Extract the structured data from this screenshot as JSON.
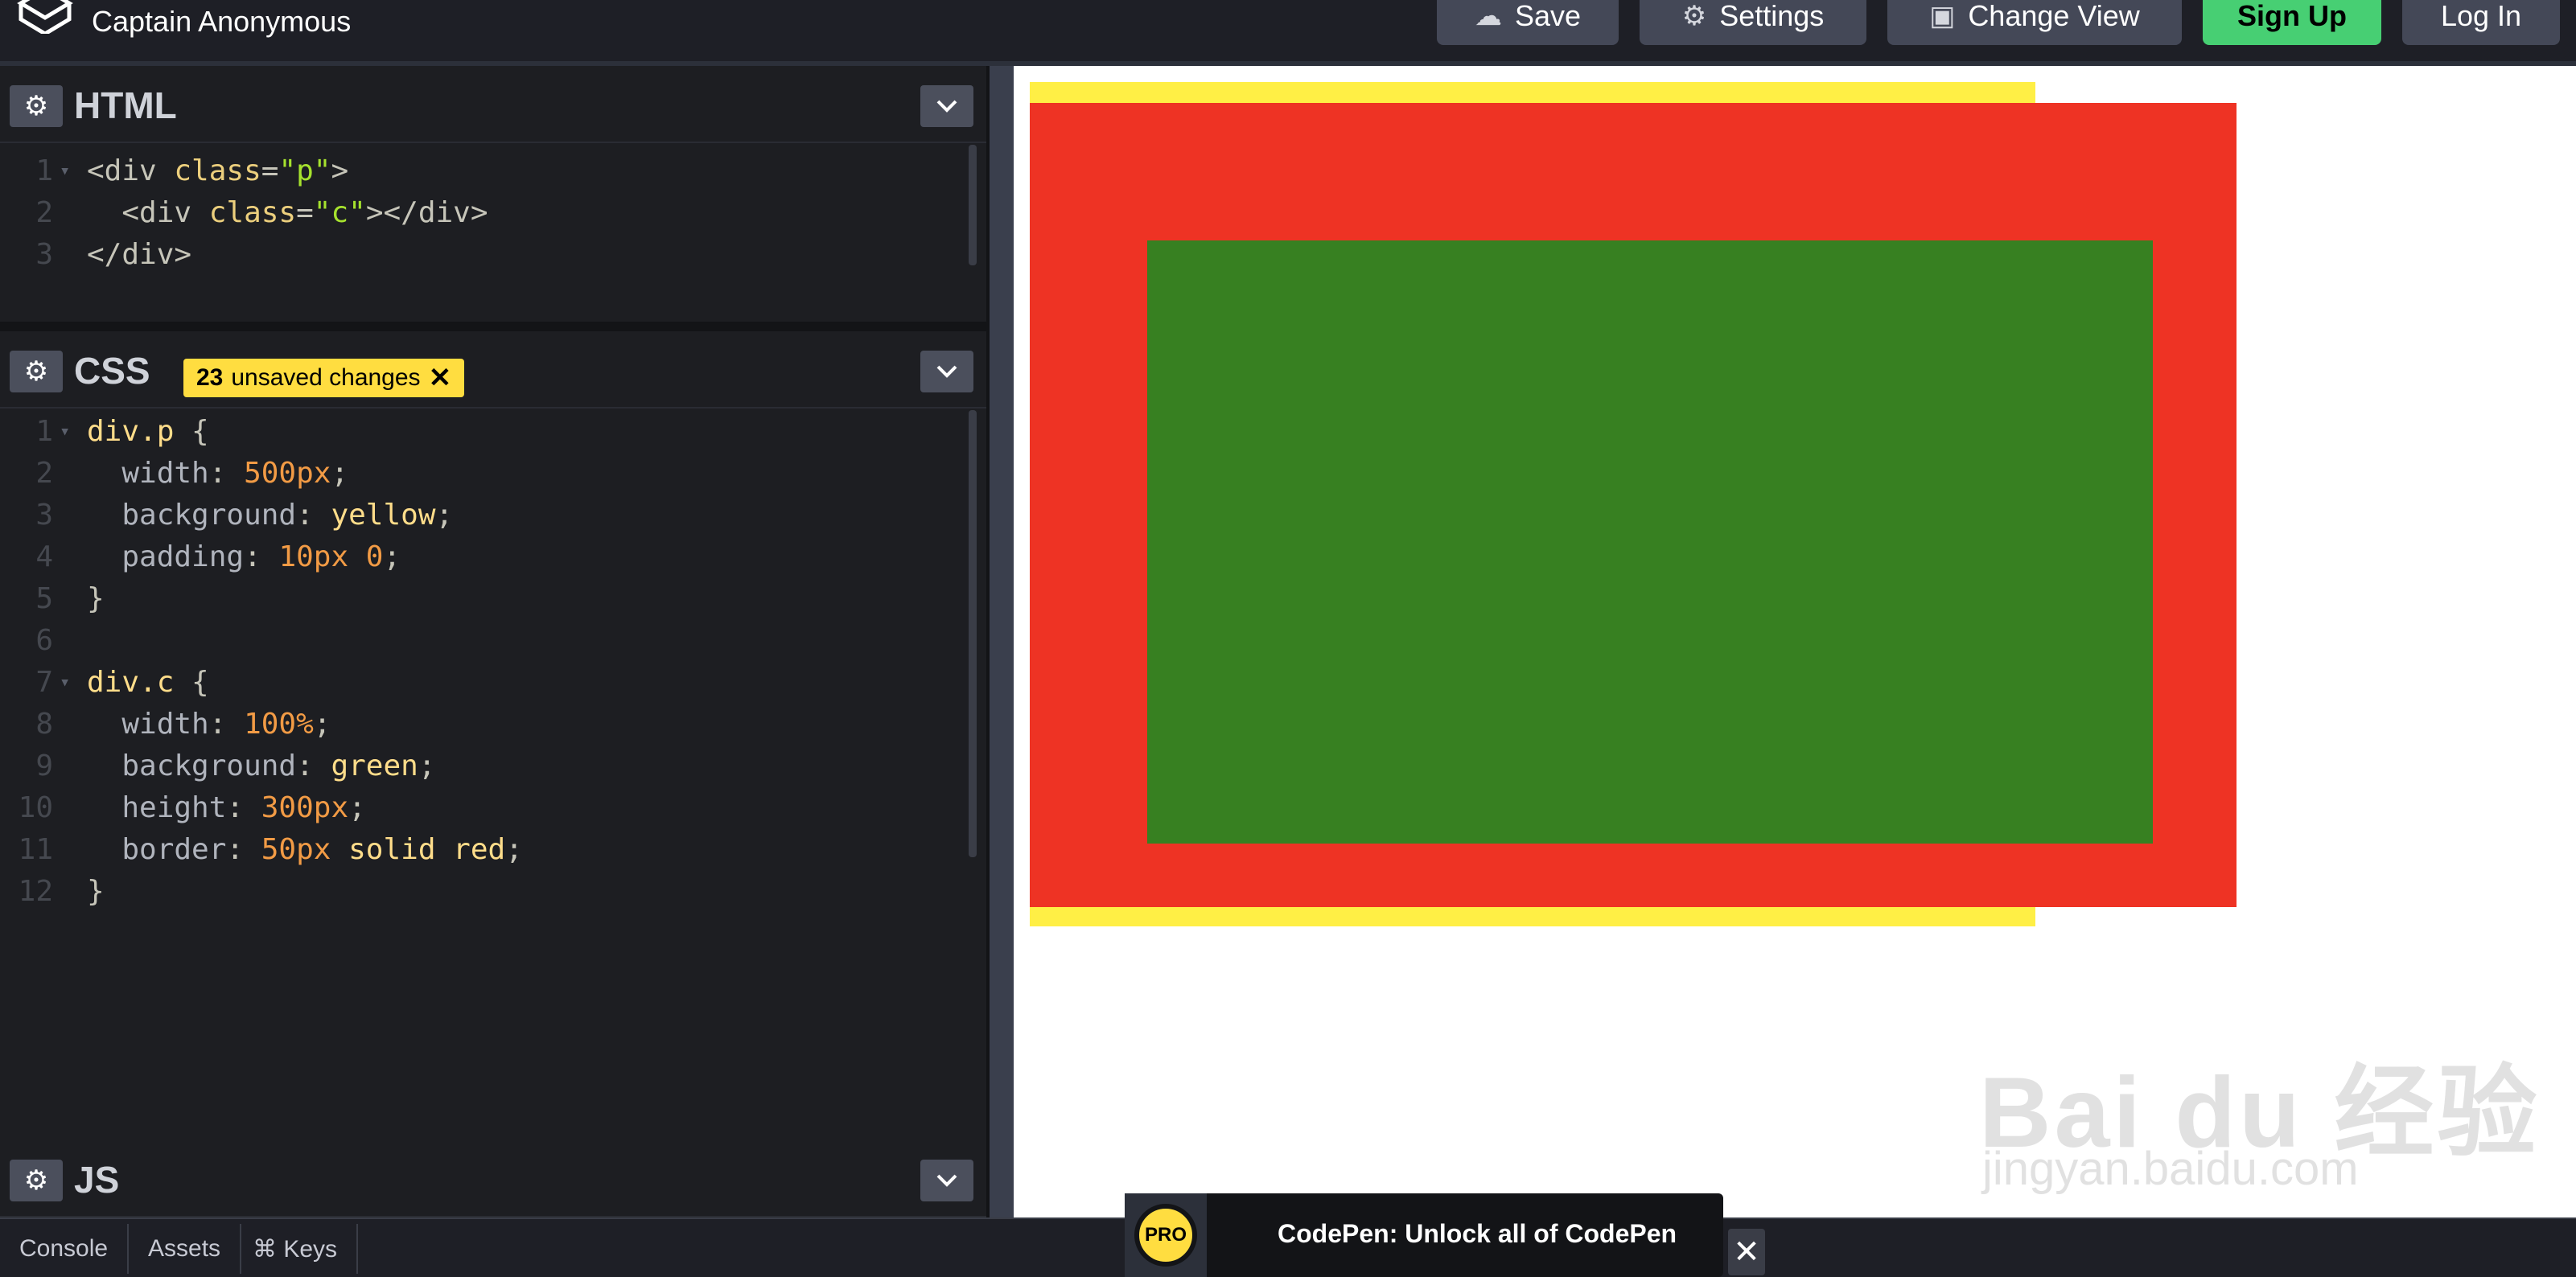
{
  "header": {
    "owner": "Captain Anonymous",
    "buttons": {
      "save": "Save",
      "settings": "Settings",
      "change_view": "Change View",
      "sign_up": "Sign Up",
      "log_in": "Log In"
    }
  },
  "panes": {
    "html": {
      "title": "HTML",
      "lines": [
        {
          "n": "1",
          "parts": [
            [
              "t-tag",
              "<div "
            ],
            [
              "t-attr",
              "class"
            ],
            [
              "t-tag",
              "="
            ],
            [
              "t-str",
              "\"p\""
            ],
            [
              "t-tag",
              ">"
            ]
          ]
        },
        {
          "n": "2",
          "parts": [
            [
              "t-tag",
              "  <div "
            ],
            [
              "t-attr",
              "class"
            ],
            [
              "t-tag",
              "="
            ],
            [
              "t-str",
              "\"c\""
            ],
            [
              "t-tag",
              "></div>"
            ]
          ]
        },
        {
          "n": "3",
          "parts": [
            [
              "t-tag",
              "</div>"
            ]
          ]
        }
      ]
    },
    "css": {
      "title": "CSS",
      "badge_count": "23",
      "badge_text": "unsaved changes",
      "lines": [
        {
          "n": "1",
          "parts": [
            [
              "t-sel",
              "div.p "
            ],
            [
              "t-tag",
              "{"
            ]
          ]
        },
        {
          "n": "2",
          "parts": [
            [
              "t-prop",
              "  width"
            ],
            [
              "t-tag",
              ": "
            ],
            [
              "t-num",
              "500px"
            ],
            [
              "t-tag",
              ";"
            ]
          ]
        },
        {
          "n": "3",
          "parts": [
            [
              "t-prop",
              "  background"
            ],
            [
              "t-tag",
              ": "
            ],
            [
              "t-kw",
              "yellow"
            ],
            [
              "t-tag",
              ";"
            ]
          ]
        },
        {
          "n": "4",
          "parts": [
            [
              "t-prop",
              "  padding"
            ],
            [
              "t-tag",
              ": "
            ],
            [
              "t-num",
              "10px 0"
            ],
            [
              "t-tag",
              ";"
            ]
          ]
        },
        {
          "n": "5",
          "parts": [
            [
              "t-tag",
              "}"
            ]
          ]
        },
        {
          "n": "6",
          "parts": []
        },
        {
          "n": "7",
          "parts": [
            [
              "t-sel",
              "div.c "
            ],
            [
              "t-tag",
              "{"
            ]
          ]
        },
        {
          "n": "8",
          "parts": [
            [
              "t-prop",
              "  width"
            ],
            [
              "t-tag",
              ": "
            ],
            [
              "t-num",
              "100%"
            ],
            [
              "t-tag",
              ";"
            ]
          ]
        },
        {
          "n": "9",
          "parts": [
            [
              "t-prop",
              "  background"
            ],
            [
              "t-tag",
              ": "
            ],
            [
              "t-kw",
              "green"
            ],
            [
              "t-tag",
              ";"
            ]
          ]
        },
        {
          "n": "10",
          "parts": [
            [
              "t-prop",
              "  height"
            ],
            [
              "t-tag",
              ": "
            ],
            [
              "t-num",
              "300px"
            ],
            [
              "t-tag",
              ";"
            ]
          ]
        },
        {
          "n": "11",
          "parts": [
            [
              "t-prop",
              "  border"
            ],
            [
              "t-tag",
              ": "
            ],
            [
              "t-num",
              "50px "
            ],
            [
              "t-kw",
              "solid red"
            ],
            [
              "t-tag",
              ";"
            ]
          ]
        },
        {
          "n": "12",
          "parts": [
            [
              "t-tag",
              "}"
            ]
          ]
        }
      ]
    },
    "js": {
      "title": "JS"
    }
  },
  "preview": {
    "colors": {
      "yellow": "#ffef45",
      "red": "#ee3324",
      "green": "#378021"
    },
    "watermark_main": "Bai du 经验",
    "watermark_sub": "jingyan.baidu.com"
  },
  "footer": {
    "console": "Console",
    "assets": "Assets",
    "keys": "⌘ Keys",
    "promo_badge": "PRO",
    "promo_text": "CodePen: Unlock all of CodePen"
  }
}
